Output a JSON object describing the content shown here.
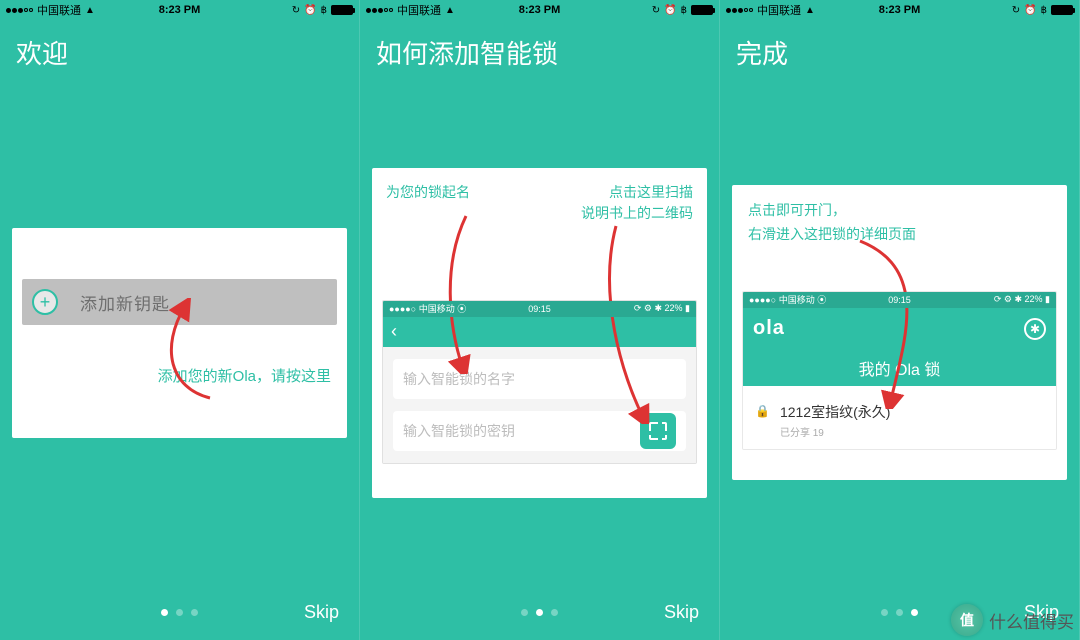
{
  "status": {
    "carrier": "中国联通",
    "time": "8:23 PM"
  },
  "skip_label": "Skip",
  "screen1": {
    "title": "欢迎",
    "add_key_label": "添加新钥匙",
    "hint": "添加您的新Ola，请按这里"
  },
  "screen2": {
    "title": "如何添加智能锁",
    "hint_name": "为您的锁起名",
    "hint_scan_l1": "点击这里扫描",
    "hint_scan_l2": "说明书上的二维码",
    "mini_carrier": "中国移动",
    "mini_time": "09:15",
    "mini_batt": "22%",
    "input_name_placeholder": "输入智能锁的名字",
    "input_key_placeholder": "输入智能锁的密钥"
  },
  "screen3": {
    "title": "完成",
    "hint_l1": "点击即可开门，",
    "hint_l2": "右滑进入这把锁的详细页面",
    "mini_carrier": "中国移动",
    "mini_time": "09:15",
    "mini_batt": "22%",
    "ola_logo": "ola",
    "sub_header": "我的 Ola 锁",
    "item_title": "1212室指纹(永久)",
    "item_sub": "已分享 19"
  },
  "watermark": {
    "badge": "值",
    "text": "什么值得买"
  }
}
